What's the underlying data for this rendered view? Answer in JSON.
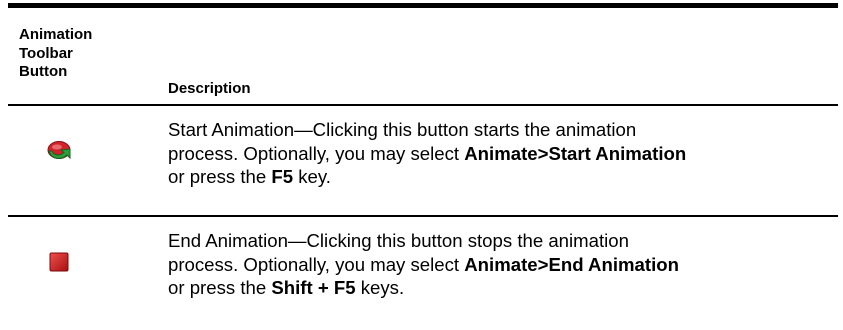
{
  "table": {
    "header_col1_lines": [
      "Animation",
      "Toolbar",
      "Button"
    ],
    "header_col2": "Description",
    "rows": [
      {
        "icon": "start-animation-icon",
        "line1": "Start Animation—Clicking this button starts the animation",
        "line2_pre": "process. Optionally, you may select ",
        "line2_bold": "Animate>Start Animation",
        "line3_pre": "or press the ",
        "line3_bold": "F5",
        "line3_post": " key."
      },
      {
        "icon": "end-animation-icon",
        "line1": "End Animation—Clicking this button stops the animation",
        "line2_pre": "process. Optionally, you may select ",
        "line2_bold": "Animate>End Animation",
        "line3_pre": "or press the ",
        "line3_bold": "Shift + F5",
        "line3_post": " keys."
      }
    ]
  },
  "colors": {
    "start_icon_red": "#d2232a",
    "start_icon_green": "#2e9e3c",
    "stop_icon_red": "#d01c1c",
    "rule": "#000000"
  }
}
